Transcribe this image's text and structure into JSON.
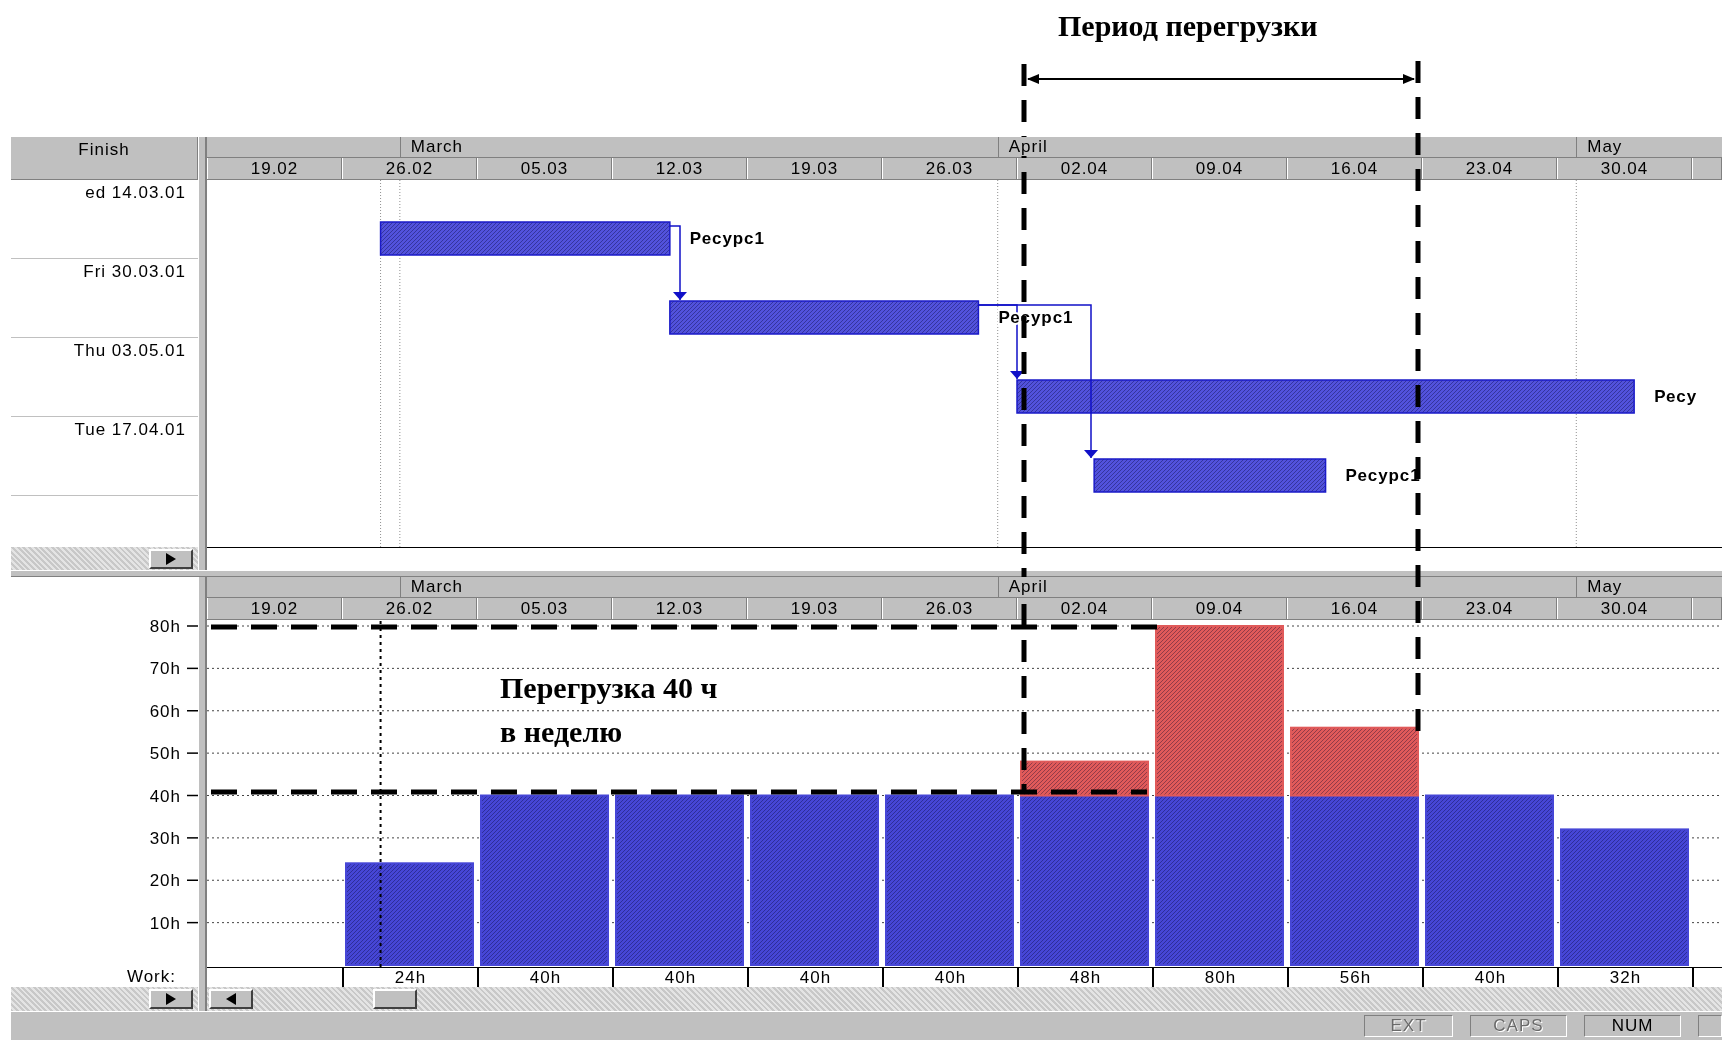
{
  "annotations": {
    "period_title": "Период перегрузки",
    "overload_note": "Перегрузка 40 ч\nв неделю"
  },
  "gantt": {
    "finish_header": "Finish",
    "months": [
      "March",
      "April",
      "May"
    ],
    "weeks": [
      "19.02",
      "26.02",
      "05.03",
      "12.03",
      "19.03",
      "26.03",
      "02.04",
      "09.04",
      "16.04",
      "23.04",
      "30.04"
    ],
    "rows": [
      {
        "finish": "ed 14.03.01",
        "resource": "Ресурс1"
      },
      {
        "finish": "Fri 30.03.01",
        "resource": "Ресурс1"
      },
      {
        "finish": "Thu 03.05.01",
        "resource": "Ресу"
      },
      {
        "finish": "Tue 17.04.01",
        "resource": "Ресурс1"
      }
    ]
  },
  "histogram": {
    "months": [
      "March",
      "April",
      "May"
    ],
    "work_label": "Work:",
    "chart_data": {
      "type": "bar",
      "stacked": true,
      "grid": true,
      "categories": [
        "19.02",
        "26.02",
        "05.03",
        "12.03",
        "19.03",
        "26.03",
        "02.04",
        "09.04",
        "16.04",
        "23.04",
        "30.04"
      ],
      "series": [
        {
          "color": "#4646d6",
          "values": [
            null,
            24,
            40,
            40,
            40,
            40,
            40,
            40,
            40,
            40,
            32
          ]
        },
        {
          "color": "#e05a5a",
          "values": [
            null,
            0,
            0,
            0,
            0,
            0,
            8,
            40,
            16,
            0,
            0
          ]
        }
      ],
      "ylim": [
        0,
        80
      ],
      "yticks": [
        {
          "value": 10,
          "label": "10h"
        },
        {
          "value": 20,
          "label": "20h"
        },
        {
          "value": 30,
          "label": "30h"
        },
        {
          "value": 40,
          "label": "40h"
        },
        {
          "value": 50,
          "label": "50h"
        },
        {
          "value": 60,
          "label": "60h"
        },
        {
          "value": 70,
          "label": "70h"
        },
        {
          "value": 80,
          "label": "80h"
        }
      ],
      "value_labels": [
        null,
        "24h",
        "40h",
        "40h",
        "40h",
        "40h",
        "48h",
        "80h",
        "56h",
        "40h",
        "32h"
      ]
    }
  },
  "status_bar": {
    "indicators": [
      {
        "label": "EXT",
        "on": false
      },
      {
        "label": "CAPS",
        "on": false
      },
      {
        "label": "NUM",
        "on": true
      }
    ]
  }
}
